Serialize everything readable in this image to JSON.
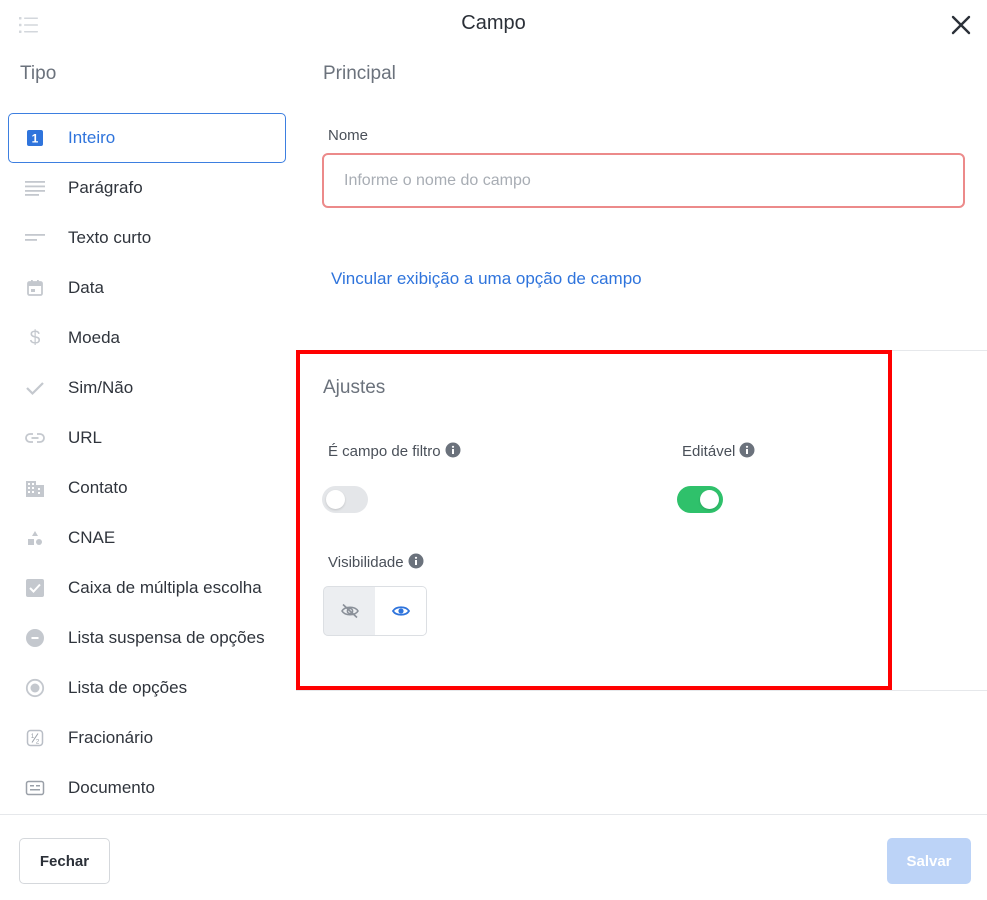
{
  "header": {
    "title": "Campo"
  },
  "sidebar": {
    "heading": "Tipo",
    "items": [
      {
        "label": "Inteiro",
        "icon": "number-one-icon",
        "active": true
      },
      {
        "label": "Parágrafo",
        "icon": "paragraph-lines-icon"
      },
      {
        "label": "Texto curto",
        "icon": "short-text-icon"
      },
      {
        "label": "Data",
        "icon": "calendar-icon"
      },
      {
        "label": "Moeda",
        "icon": "dollar-icon"
      },
      {
        "label": "Sim/Não",
        "icon": "check-icon"
      },
      {
        "label": "URL",
        "icon": "link-icon"
      },
      {
        "label": "Contato",
        "icon": "building-icon"
      },
      {
        "label": "CNAE",
        "icon": "shapes-icon"
      },
      {
        "label": "Caixa de múltipla escolha",
        "icon": "checkbox-icon"
      },
      {
        "label": "Lista suspensa de opções",
        "icon": "dropdown-circle-icon"
      },
      {
        "label": "Lista de opções",
        "icon": "radio-icon"
      },
      {
        "label": "Fracionário",
        "icon": "fraction-icon"
      },
      {
        "label": "Documento",
        "icon": "document-card-icon"
      }
    ]
  },
  "principal": {
    "title": "Principal",
    "name_label": "Nome",
    "name_value": "",
    "name_placeholder": "Informe o nome do campo",
    "link_text": "Vincular exibição a uma opção de campo"
  },
  "settings": {
    "title": "Ajustes",
    "filter_label": "É campo de filtro",
    "filter_on": false,
    "editable_label": "Editável",
    "editable_on": true,
    "visibility_label": "Visibilidade",
    "visibility_selected": "visible"
  },
  "footer": {
    "close_label": "Fechar",
    "save_label": "Salvar"
  },
  "colors": {
    "accent": "#2f74dc",
    "toggle_on": "#2fc16b",
    "error_border": "#ec8a8a",
    "highlight": "#ff0000",
    "save_disabled": "#bcd3f7"
  }
}
